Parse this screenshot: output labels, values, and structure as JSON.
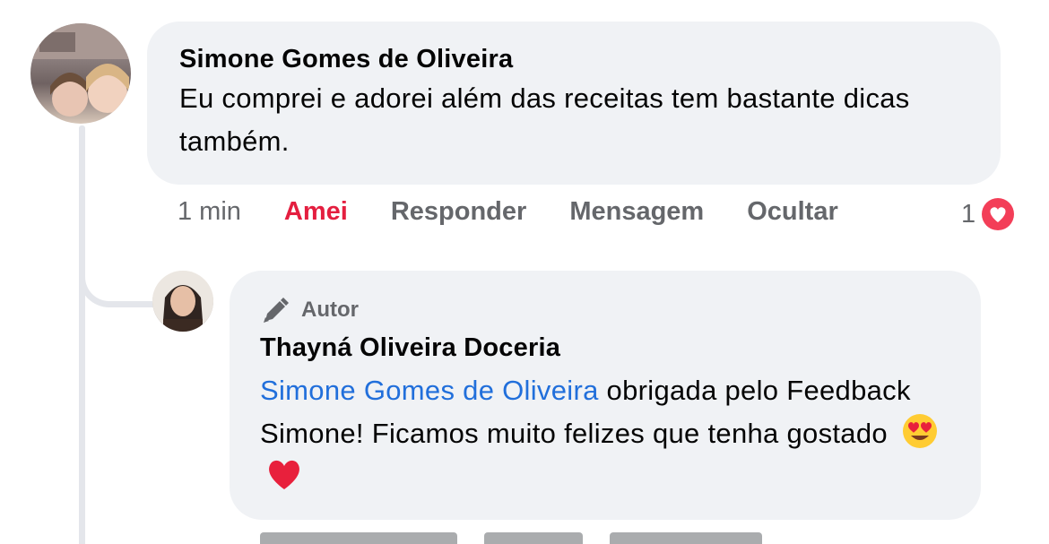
{
  "comment": {
    "author": "Simone Gomes de Oliveira",
    "text": "Eu comprei e adorei além das receitas tem bastante dicas também.",
    "actions": {
      "time": "1 min",
      "love": "Amei",
      "reply": "Responder",
      "message": "Mensagem",
      "hide": "Ocultar"
    },
    "reaction_count": "1",
    "reaction_icon": "heart-reaction-icon"
  },
  "reply": {
    "badge": "Autor",
    "badge_icon": "pencil-icon",
    "author": "Thayná Oliveira Doceria",
    "mention": "Simone Gomes de Oliveira",
    "text": " obrigada pelo Feedback Simone! Ficamos muito felizes que tenha gostado",
    "emojis": [
      "heart-eyes-emoji",
      "red-heart-emoji"
    ]
  },
  "colors": {
    "bubble": "#f0f2f5",
    "love": "#e41e3f",
    "mention": "#216fdb",
    "muted": "#65676b"
  }
}
